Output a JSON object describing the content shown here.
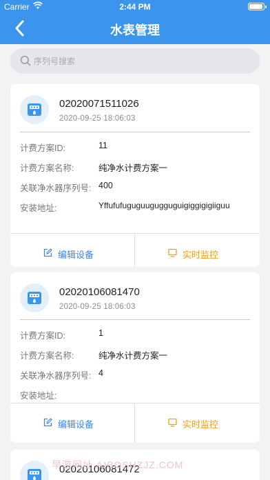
{
  "status_bar": {
    "carrier": "Carrier",
    "time": "2:44 PM"
  },
  "nav": {
    "title": "水表管理",
    "back_icon": "chevron-left-icon"
  },
  "search": {
    "placeholder": "序列号搜索",
    "value": ""
  },
  "labels": {
    "plan_id": "计费方案ID:",
    "plan_name": "计费方案名称:",
    "purifier_serial": "关联净水器序列号:",
    "address": "安装地址:",
    "edit": "编辑设备",
    "monitor": "实时监控"
  },
  "colors": {
    "primary": "#3b95ec",
    "edit": "#3b86e0",
    "monitor": "#f39c12"
  },
  "devices": [
    {
      "serial": "02020071511026",
      "date": "2020-09-25 18:06:03",
      "plan_id": "11",
      "plan_name": "纯净水计费方案一",
      "purifier_serial": "400",
      "address": "Yffufufuguguuguggugui​giggigigiiguu"
    },
    {
      "serial": "02020106081470",
      "date": "2020-09-25 18:06:03",
      "plan_id": "1",
      "plan_name": "纯净水计费方案一",
      "purifier_serial": "4",
      "address": ""
    },
    {
      "serial": "02020106081472"
    }
  ],
  "watermark": "早游网址 AIBOSHZJZ.COM"
}
